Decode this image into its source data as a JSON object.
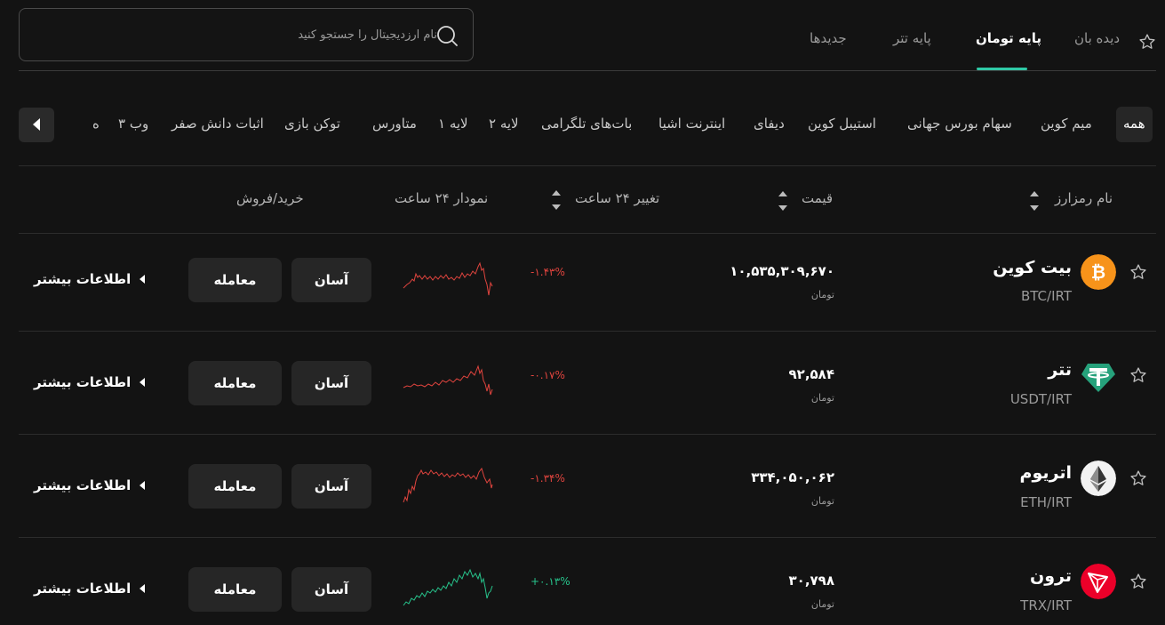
{
  "search": {
    "placeholder": "نام ارزدیجیتال را جستجو کنید"
  },
  "tabs": [
    {
      "label": "دیده بان",
      "active": false
    },
    {
      "label": "پایه تومان",
      "active": true
    },
    {
      "label": "پایه تتر",
      "active": false
    },
    {
      "label": "جدیدها",
      "active": false
    }
  ],
  "categories": [
    {
      "label": "همه",
      "active": true
    },
    {
      "label": "میم کوین"
    },
    {
      "label": "سهام بورس جهانی"
    },
    {
      "label": "استیبل کوین"
    },
    {
      "label": "دیفای"
    },
    {
      "label": "اینترنت اشیا"
    },
    {
      "label": "بات‌های تلگرامی"
    },
    {
      "label": "لایه ۲"
    },
    {
      "label": "لایه ۱"
    },
    {
      "label": "متاورس"
    },
    {
      "label": "توکن بازی"
    },
    {
      "label": "اثبات دانش صفر"
    },
    {
      "label": "وب ۳"
    },
    {
      "label": "ه"
    }
  ],
  "table_header": {
    "name": "نام رمزارز",
    "price": "قیمت",
    "change": "تغییر ۲۴ ساعت",
    "chart": "نمودار ۲۴ ساعت",
    "trade": "خرید/فروش"
  },
  "colors": {
    "accent": "#2fc9a6",
    "negative": "#e0443e",
    "positive": "#27c48c"
  },
  "rows": [
    {
      "name": "بیت کوین",
      "pair": "BTC/IRT",
      "price": "۱۰,۵۳۵,۳۰۹,۶۷۰",
      "unit": "تومان",
      "change": "-۱.۴۳%",
      "direction": "down",
      "icon": "bitcoin-icon",
      "asan_label": "آسان",
      "trade_label": "معامله",
      "more_label": "اطلاعات بیشتر"
    },
    {
      "name": "تتر",
      "pair": "USDT/IRT",
      "price": "۹۲,۵۸۴",
      "unit": "تومان",
      "change": "-۰.۱۷%",
      "direction": "down",
      "icon": "tether-icon",
      "asan_label": "آسان",
      "trade_label": "معامله",
      "more_label": "اطلاعات بیشتر"
    },
    {
      "name": "اتریوم",
      "pair": "ETH/IRT",
      "price": "۳۳۴,۰۵۰,۰۶۲",
      "unit": "تومان",
      "change": "-۱.۳۴%",
      "direction": "down",
      "icon": "ethereum-icon",
      "asan_label": "آسان",
      "trade_label": "معامله",
      "more_label": "اطلاعات بیشتر"
    },
    {
      "name": "ترون",
      "pair": "TRX/IRT",
      "price": "۳۰,۷۹۸",
      "unit": "تومان",
      "change": "+۰.۱۳%",
      "direction": "up",
      "icon": "tron-icon",
      "asan_label": "آسان",
      "trade_label": "معامله",
      "more_label": "اطلاعات بیشتر"
    }
  ]
}
